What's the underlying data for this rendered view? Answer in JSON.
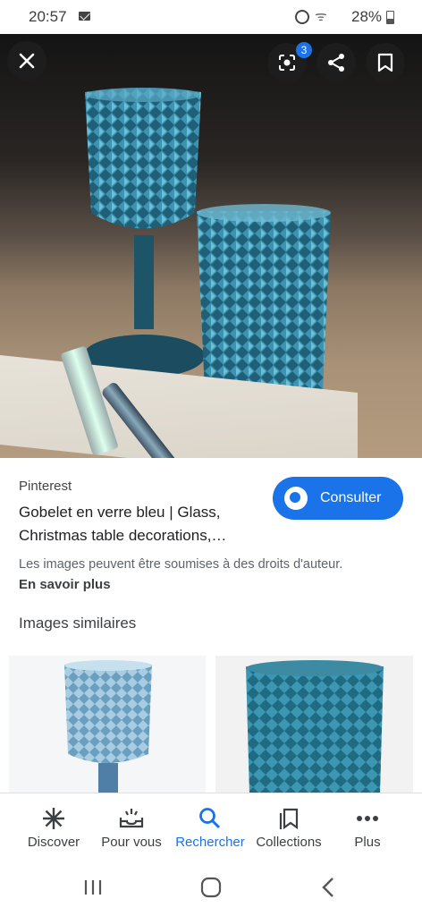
{
  "status_bar": {
    "time": "20:57",
    "battery": "28%"
  },
  "viewer": {
    "lens_badge_count": "3"
  },
  "result": {
    "source": "Pinterest",
    "title_line1": "Gobelet en verre bleu | Glass,",
    "title_line2": "Christmas table decorations,…",
    "consult_label": "Consulter",
    "rights_notice": "Les images peuvent être soumises à des droits d'auteur.",
    "learn_more": "En savoir plus"
  },
  "similar": {
    "title": "Images similaires"
  },
  "bottom_nav": {
    "items": [
      {
        "label": "Discover",
        "icon": "asterisk-icon"
      },
      {
        "label": "Pour vous",
        "icon": "inbox-sparkle-icon"
      },
      {
        "label": "Rechercher",
        "icon": "search-icon"
      },
      {
        "label": "Collections",
        "icon": "collections-bookmark-icon"
      },
      {
        "label": "Plus",
        "icon": "more-dots-icon"
      }
    ],
    "active_index": 2
  },
  "colors": {
    "accent": "#1a73e8",
    "text": "#202124"
  }
}
